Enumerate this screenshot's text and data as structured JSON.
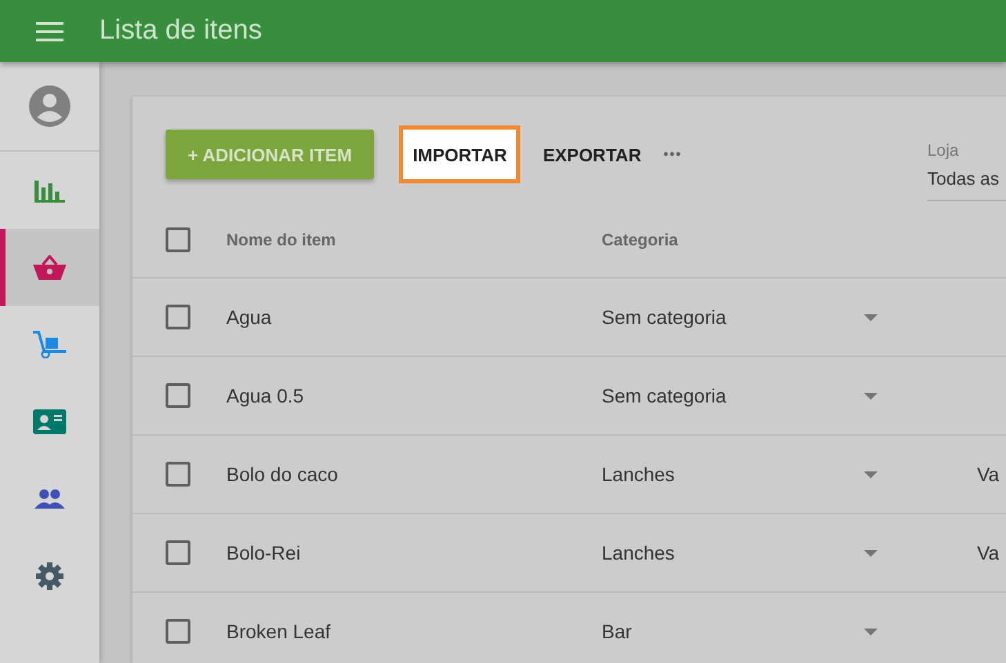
{
  "app_bar": {
    "title": "Lista de itens"
  },
  "sidebar": {
    "items": [
      {
        "kind": "chart",
        "selected": false
      },
      {
        "kind": "basket",
        "selected": true
      },
      {
        "kind": "cart",
        "selected": false
      },
      {
        "kind": "card",
        "selected": false
      },
      {
        "kind": "people",
        "selected": false
      },
      {
        "kind": "gear",
        "selected": false
      }
    ]
  },
  "toolbar": {
    "add_button": "+ ADICIONAR ITEM",
    "import_button": "IMPORTAR",
    "export_button": "EXPORTAR",
    "more_button": "•••",
    "store_field": {
      "label": "Loja",
      "value": "Todas as"
    }
  },
  "table": {
    "header_checked": false,
    "columns": [
      "Nome do item",
      "Categoria"
    ],
    "rows": [
      {
        "name": "Agua",
        "category": "Sem categoria",
        "column_3": "",
        "checked": false
      },
      {
        "name": "Agua 0.5",
        "category": "Sem categoria",
        "column_3": "",
        "checked": false
      },
      {
        "name": "Bolo do caco",
        "category": "Lanches",
        "column_3": "Va",
        "checked": false
      },
      {
        "name": "Bolo-Rei",
        "category": "Lanches",
        "column_3": "Va",
        "checked": false
      },
      {
        "name": "Broken Leaf",
        "category": "Bar",
        "column_3": "",
        "checked": false
      }
    ]
  }
}
